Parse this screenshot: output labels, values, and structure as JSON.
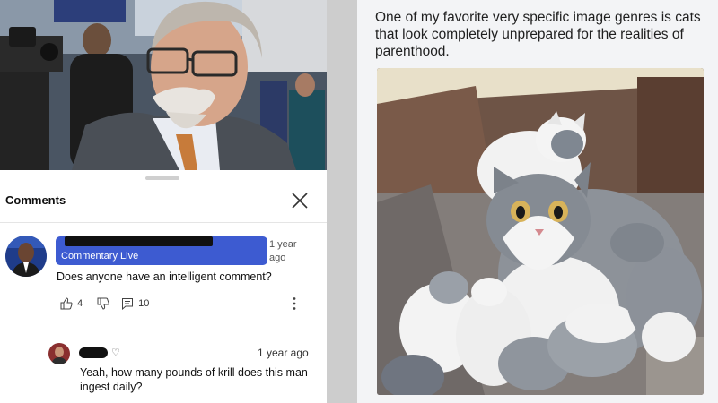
{
  "comments_sheet": {
    "title": "Comments",
    "close_icon": "close-icon"
  },
  "top_comment": {
    "author_label": "Commentary Live",
    "time": "1 year ago",
    "text": "Does anyone have an intelligent comment?",
    "likes": "4",
    "replies": "10",
    "icons": [
      "thumbs-up-icon",
      "thumbs-down-icon",
      "reply-icon",
      "more-vertical-icon"
    ]
  },
  "reply": {
    "heart": "♡",
    "time": "1 year ago",
    "text": "Yeah, how many pounds of krill does this man ingest daily?"
  },
  "post": {
    "caption": "One of my favorite very specific image genres is cats that look completely unprepared for the realities of parenthood."
  },
  "colors": {
    "redaction_blue": "#3d5bd1",
    "redaction_black": "#111111",
    "separator": "#cdcdcd",
    "right_background": "#f3f4f6"
  }
}
